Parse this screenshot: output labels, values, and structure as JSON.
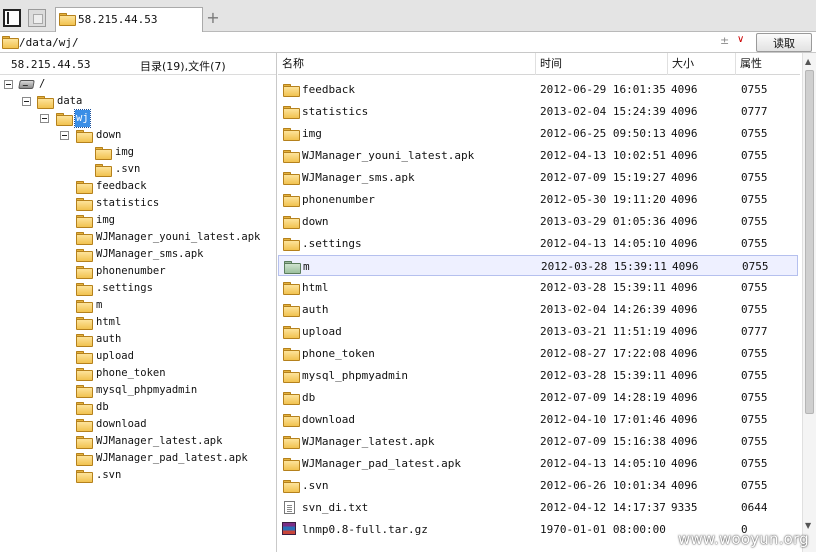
{
  "tab": {
    "title": "58.215.44.53",
    "add_label": "+"
  },
  "address": {
    "path": "/data/wj/",
    "updown_label": "±",
    "dropdown_label": "∨",
    "read_label": "读取"
  },
  "left": {
    "host": "58.215.44.53",
    "summary": "目录(19),文件(7)"
  },
  "tree": [
    {
      "label": "/"
    },
    {
      "label": "data"
    },
    {
      "label": "wj"
    },
    {
      "label": "down"
    },
    {
      "label": "img"
    },
    {
      "label": ".svn"
    },
    {
      "label": "feedback"
    },
    {
      "label": "statistics"
    },
    {
      "label": "img"
    },
    {
      "label": "WJManager_youni_latest.apk"
    },
    {
      "label": "WJManager_sms.apk"
    },
    {
      "label": "phonenumber"
    },
    {
      "label": ".settings"
    },
    {
      "label": "m"
    },
    {
      "label": "html"
    },
    {
      "label": "auth"
    },
    {
      "label": "upload"
    },
    {
      "label": "phone_token"
    },
    {
      "label": "mysql_phpmyadmin"
    },
    {
      "label": "db"
    },
    {
      "label": "download"
    },
    {
      "label": "WJManager_latest.apk"
    },
    {
      "label": "WJManager_pad_latest.apk"
    },
    {
      "label": ".svn"
    }
  ],
  "columns": {
    "name": "名称",
    "time": "时间",
    "size": "大小",
    "attr": "属性"
  },
  "files": [
    {
      "name": "feedback",
      "time": "2012-06-29 16:01:35",
      "size": "4096",
      "attr": "0755"
    },
    {
      "name": "statistics",
      "time": "2013-02-04 15:24:39",
      "size": "4096",
      "attr": "0777"
    },
    {
      "name": "img",
      "time": "2012-06-25 09:50:13",
      "size": "4096",
      "attr": "0755"
    },
    {
      "name": "WJManager_youni_latest.apk",
      "time": "2012-04-13 10:02:51",
      "size": "4096",
      "attr": "0755"
    },
    {
      "name": "WJManager_sms.apk",
      "time": "2012-07-09 15:19:27",
      "size": "4096",
      "attr": "0755"
    },
    {
      "name": "phonenumber",
      "time": "2012-05-30 19:11:20",
      "size": "4096",
      "attr": "0755"
    },
    {
      "name": "down",
      "time": "2013-03-29 01:05:36",
      "size": "4096",
      "attr": "0755"
    },
    {
      "name": ".settings",
      "time": "2012-04-13 14:05:10",
      "size": "4096",
      "attr": "0755"
    },
    {
      "name": "m",
      "time": "2012-03-28 15:39:11",
      "size": "4096",
      "attr": "0755"
    },
    {
      "name": "html",
      "time": "2012-03-28 15:39:11",
      "size": "4096",
      "attr": "0755"
    },
    {
      "name": "auth",
      "time": "2013-02-04 14:26:39",
      "size": "4096",
      "attr": "0755"
    },
    {
      "name": "upload",
      "time": "2013-03-21 11:51:19",
      "size": "4096",
      "attr": "0777"
    },
    {
      "name": "phone_token",
      "time": "2012-08-27 17:22:08",
      "size": "4096",
      "attr": "0755"
    },
    {
      "name": "mysql_phpmyadmin",
      "time": "2012-03-28 15:39:11",
      "size": "4096",
      "attr": "0755"
    },
    {
      "name": "db",
      "time": "2012-07-09 14:28:19",
      "size": "4096",
      "attr": "0755"
    },
    {
      "name": "download",
      "time": "2012-04-10 17:01:46",
      "size": "4096",
      "attr": "0755"
    },
    {
      "name": "WJManager_latest.apk",
      "time": "2012-07-09 15:16:38",
      "size": "4096",
      "attr": "0755"
    },
    {
      "name": "WJManager_pad_latest.apk",
      "time": "2012-04-13 14:05:10",
      "size": "4096",
      "attr": "0755"
    },
    {
      "name": ".svn",
      "time": "2012-06-26 10:01:34",
      "size": "4096",
      "attr": "0755"
    },
    {
      "name": "svn_di.txt",
      "time": "2012-04-12 14:17:37",
      "size": "9335",
      "attr": "0644"
    },
    {
      "name": "lnmp0.8-full.tar.gz",
      "time": "1970-01-01 08:00:00",
      "size": "",
      "attr": "0"
    }
  ],
  "scrollbar": {
    "up": "▲",
    "down": "▼"
  },
  "watermark": "www.wooyun.org"
}
